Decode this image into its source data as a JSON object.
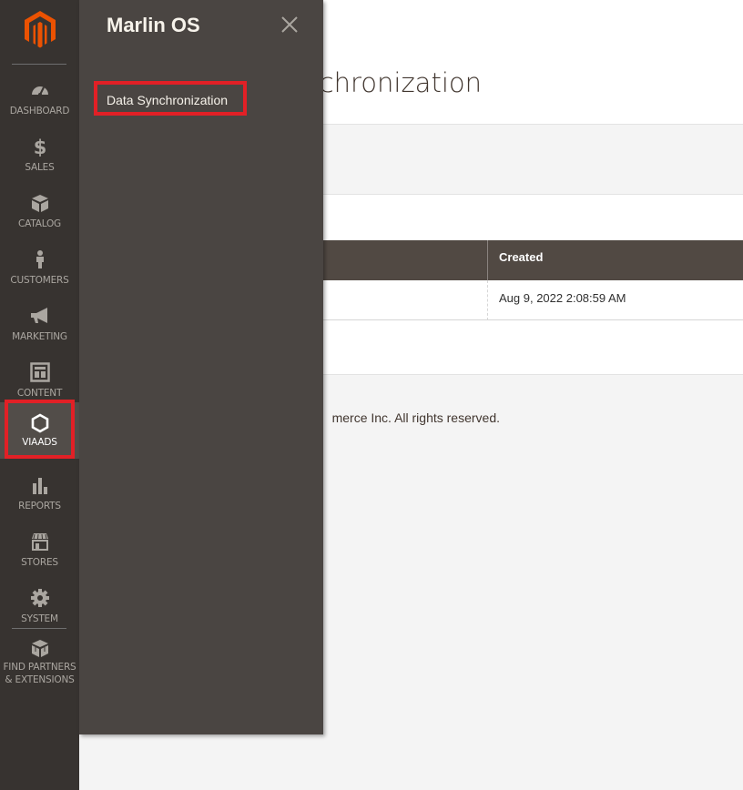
{
  "nav": {
    "items": [
      {
        "label": "DASHBOARD",
        "icon": "dashboard-icon"
      },
      {
        "label": "SALES",
        "icon": "dollar-icon"
      },
      {
        "label": "CATALOG",
        "icon": "box-icon"
      },
      {
        "label": "CUSTOMERS",
        "icon": "person-icon"
      },
      {
        "label": "MARKETING",
        "icon": "megaphone-icon"
      },
      {
        "label": "CONTENT",
        "icon": "layout-icon"
      },
      {
        "label": "VIAADS",
        "icon": "hexagon-icon"
      },
      {
        "label": "REPORTS",
        "icon": "bar-chart-icon"
      },
      {
        "label": "STORES",
        "icon": "storefront-icon"
      },
      {
        "label": "SYSTEM",
        "icon": "gear-icon"
      },
      {
        "label": "FIND PARTNERS & EXTENSIONS",
        "icon": "blocks-icon"
      }
    ],
    "active": "VIAADS"
  },
  "submenu": {
    "title": "Marlin OS",
    "items": [
      {
        "label": "Data Synchronization"
      }
    ]
  },
  "main": {
    "title_visible": "nchronization",
    "grid": {
      "columns": [
        "Created"
      ],
      "rows": [
        {
          "created": "Aug 9, 2022 2:08:59 AM"
        }
      ]
    },
    "footer": {
      "copyright_visible": "merce Inc. All rights reserved."
    }
  },
  "colors": {
    "nav_bg": "#373330",
    "submenu_bg": "#4a4542",
    "highlight": "#e22026",
    "brand": "#eb5202",
    "grid_header": "#514943"
  }
}
